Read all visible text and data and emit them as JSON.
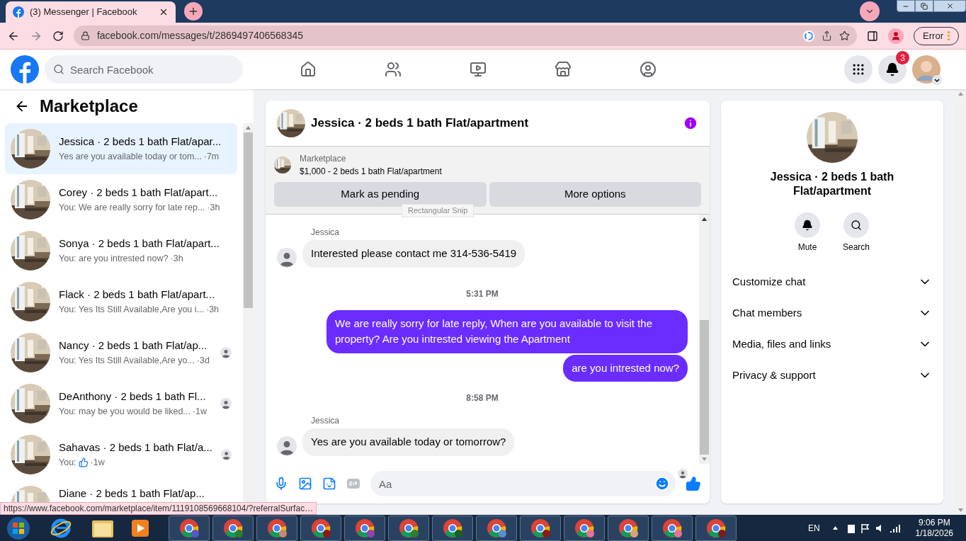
{
  "browser": {
    "tab_title": "(3) Messenger | Facebook",
    "url": "facebook.com/messages/t/2869497406568345",
    "profile_button": "Error",
    "status_url": "https://www.facebook.com/marketplace/item/1119108569668104/?referralSurfac…"
  },
  "facebook": {
    "search_placeholder": "Search Facebook",
    "notification_count": "3"
  },
  "sidebar": {
    "title": "Marketplace",
    "chats": [
      {
        "title": "Jessica · 2 beds 1 bath Flat/apar...",
        "preview": "Yes are you available today or tom...",
        "time": "·7m",
        "selected": true,
        "read_receipt": false,
        "like_sticker": false
      },
      {
        "title": "Corey · 2 beds 1 bath Flat/apart...",
        "preview": "You: We are really sorry for late rep...",
        "time": "·3h",
        "selected": false,
        "read_receipt": false,
        "like_sticker": false
      },
      {
        "title": "Sonya · 2 beds 1 bath Flat/apart...",
        "preview": "You: are you intrested now?",
        "time": "·3h",
        "selected": false,
        "read_receipt": false,
        "like_sticker": false
      },
      {
        "title": "Flack · 2 beds 1 bath Flat/apart...",
        "preview": "You: Yes Its Still Available,Are you i...",
        "time": "·3h",
        "selected": false,
        "read_receipt": false,
        "like_sticker": false
      },
      {
        "title": "Nancy · 2 beds 1 bath Flat/ap...",
        "preview": "You: Yes Its Still Available,Are yo...",
        "time": "·3d",
        "selected": false,
        "read_receipt": true,
        "like_sticker": false
      },
      {
        "title": "DeAnthony · 2 beds 1 bath Fl...",
        "preview": "You: may be you would be liked...",
        "time": "·1w",
        "selected": false,
        "read_receipt": true,
        "like_sticker": false
      },
      {
        "title": "Sahavas · 2 beds 1 bath Flat/a...",
        "preview": "You:",
        "time": "·1w",
        "selected": false,
        "read_receipt": true,
        "like_sticker": true
      },
      {
        "title": "Diane · 2 beds 1 bath Flat/ap...",
        "selected": false,
        "read_receipt": false,
        "like_sticker": false
      }
    ]
  },
  "chat": {
    "title": "Jessica · 2 beds 1 bath Flat/apartment",
    "listing": {
      "label": "Marketplace",
      "item": "$1,000 - 2 beds 1 bath Flat/apartment"
    },
    "actions": [
      "Mark as pending",
      "More options"
    ],
    "snip_tooltip": "Rectangular Snip",
    "messages": [
      {
        "kind": "incoming",
        "sender": "Jessica",
        "text": "Interested please contact me 314-536-5419"
      },
      {
        "kind": "time",
        "text": "5:31 PM"
      },
      {
        "kind": "outgoing",
        "text": "We are really sorry for late reply, When are you available to visit the property? Are you intrested viewing the Apartment"
      },
      {
        "kind": "outgoing",
        "text": "are you intrested now?"
      },
      {
        "kind": "time",
        "text": "8:58 PM"
      },
      {
        "kind": "incoming",
        "sender": "Jessica",
        "text": "Yes are you available today or tomorrow?"
      }
    ],
    "composer_placeholder": "Aa"
  },
  "details": {
    "name": "Jessica · 2 beds 1 bath Flat/apartment",
    "buttons": [
      "Mute",
      "Search"
    ],
    "sections": [
      "Customize chat",
      "Chat members",
      "Media, files and links",
      "Privacy & support"
    ]
  },
  "taskbar": {
    "language": "EN",
    "time": "9:06 PM",
    "date": "1/18/2026",
    "browser_windows": [
      {
        "color": "#5a55c8"
      },
      {
        "color": "#2e7d32"
      },
      {
        "color": "#c48a6a"
      },
      {
        "color": "#8b1a1a"
      },
      {
        "color": "#8e44ad"
      },
      {
        "color": "#2e7d32"
      },
      {
        "color": "#1b5e20"
      },
      {
        "color": "#5b8dd6"
      },
      {
        "color": "#8b1a1a"
      },
      {
        "color": "#e57399"
      },
      {
        "color": "#d9a07a"
      },
      {
        "color": "#e57399"
      },
      {
        "color": "#7b1a2a"
      }
    ]
  }
}
